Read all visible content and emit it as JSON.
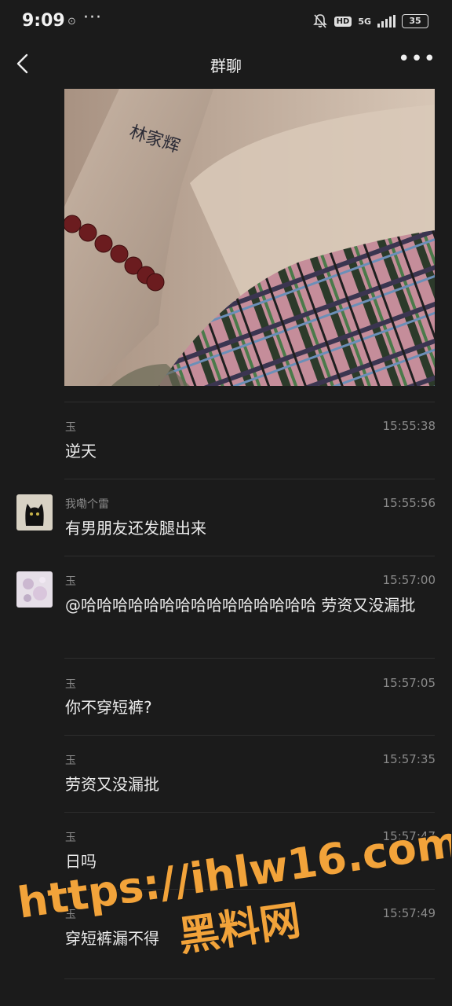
{
  "status_bar": {
    "time": "9:09",
    "extra_icon": "⊙",
    "dots": "···",
    "hd": "HD",
    "network": "5G",
    "battery": "35"
  },
  "nav": {
    "title": "群聊",
    "more": "•••"
  },
  "messages": [
    {
      "sender": "玉",
      "time": "15:55:38",
      "text": "逆天"
    },
    {
      "sender": "我嘞个雷",
      "time": "15:55:56",
      "text": "有男朋友还发腿出来"
    },
    {
      "sender": "玉",
      "time": "15:57:00",
      "text": "@哈哈哈哈哈哈哈哈哈哈哈哈哈哈哈 劳资又没漏批"
    },
    {
      "sender": "玉",
      "time": "15:57:05",
      "text": "你不穿短裤?"
    },
    {
      "sender": "玉",
      "time": "15:57:35",
      "text": "劳资又没漏批"
    },
    {
      "sender": "玉",
      "time": "15:57:47",
      "text": "日吗"
    },
    {
      "sender": "玉",
      "time": "15:57:49",
      "text": "穿短裤漏不得"
    }
  ],
  "photo": {
    "tattoo_text": "林家辉"
  },
  "watermark": {
    "url": "https://ihlw16.com",
    "name": "黑料网",
    "color": "#f2a33a"
  }
}
